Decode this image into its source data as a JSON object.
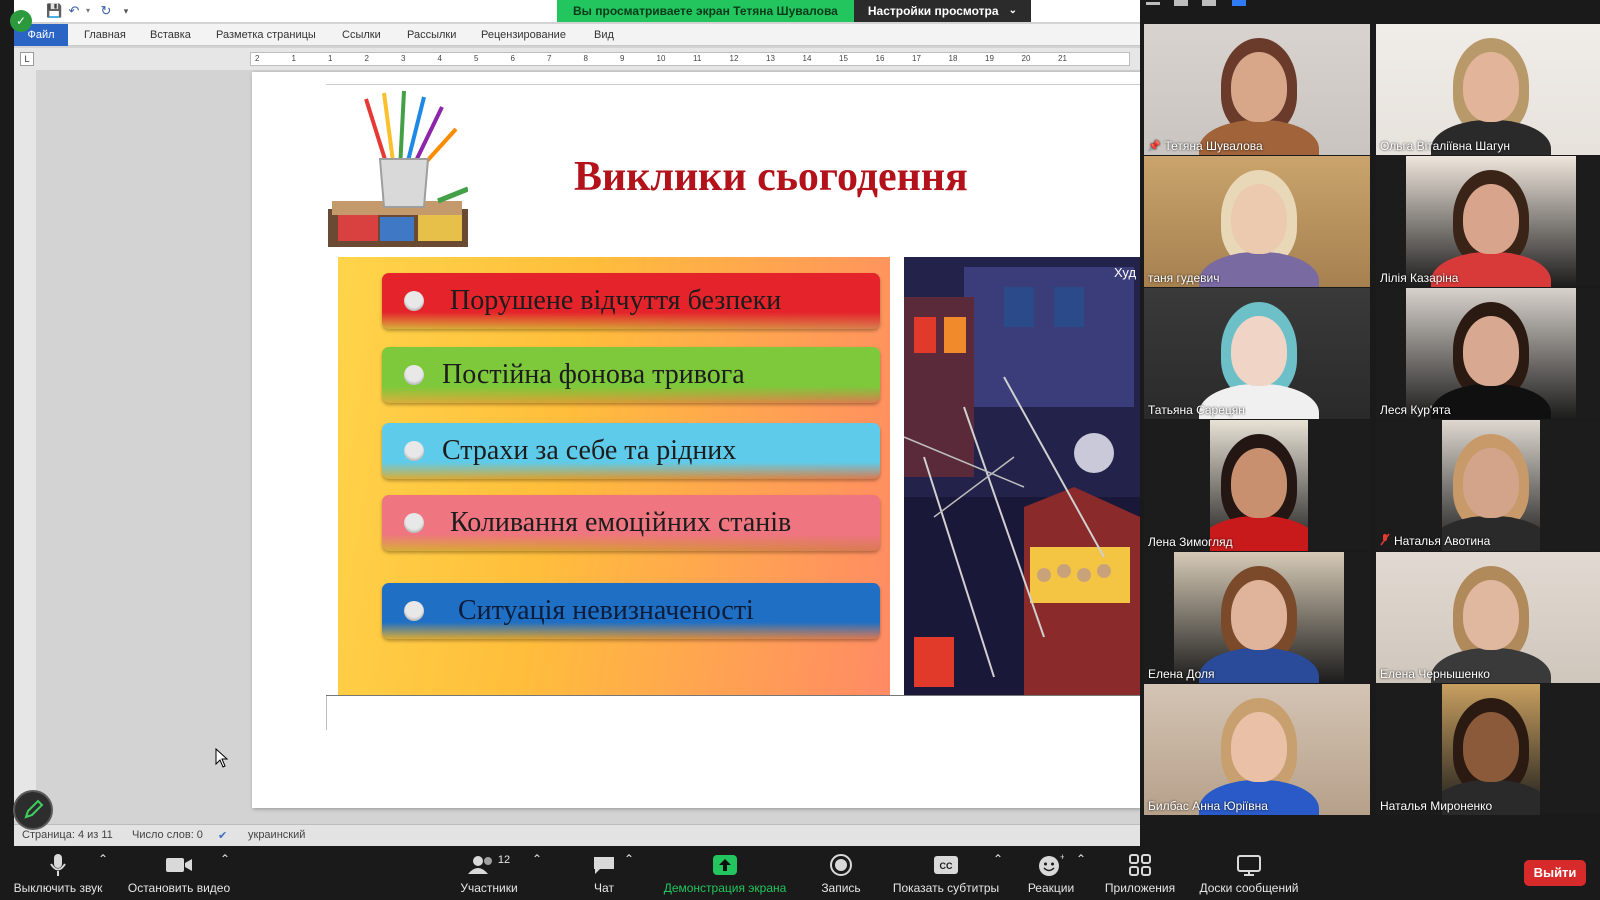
{
  "banner": {
    "viewing_text": "Вы просматриваете экран Тетяна Шувалова",
    "settings_label": "Настройки просмотра"
  },
  "word": {
    "ribbon_tabs": [
      "Файл",
      "Главная",
      "Вставка",
      "Разметка страницы",
      "Ссылки",
      "Рассылки",
      "Рецензирование",
      "Вид"
    ],
    "tab_selector": "L",
    "ruler_numbers": [
      "2",
      "1",
      "1",
      "2",
      "3",
      "4",
      "5",
      "6",
      "7",
      "8",
      "9",
      "10",
      "11",
      "12",
      "13",
      "14",
      "15",
      "16",
      "17",
      "18",
      "19",
      "20",
      "21"
    ],
    "status": {
      "page": "Страница: 4 из 11",
      "words": "Число слов: 0",
      "language": "украинский"
    }
  },
  "slide": {
    "title": "Виклики сьогодення",
    "items": [
      {
        "text": "Порушене відчуття безпеки",
        "color": "#e5232b"
      },
      {
        "text": "Постійна фонова тривога",
        "color": "#7dc93b"
      },
      {
        "text": "Страхи за себе та рідних",
        "color": "#5fcbea"
      },
      {
        "text": "Коливання емоційних станів",
        "color": "#ef7580"
      },
      {
        "text": "Ситуація невизначеності",
        "color": "#1f6fc4"
      }
    ],
    "art_label": "Худ"
  },
  "participants": [
    {
      "name": "Тетяна Шувалова",
      "pinned": true,
      "muted": false,
      "active": false
    },
    {
      "name": "Ольга Віталіївна Шагун",
      "pinned": false,
      "muted": false,
      "active": false
    },
    {
      "name": "таня гудевич",
      "pinned": false,
      "muted": false,
      "active": true
    },
    {
      "name": "Лілія Казаріна",
      "pinned": false,
      "muted": false,
      "active": false
    },
    {
      "name": "Татьяна Сарецян",
      "pinned": false,
      "muted": false,
      "active": false
    },
    {
      "name": "Леся Кур'ята",
      "pinned": false,
      "muted": false,
      "active": false
    },
    {
      "name": "Лена Зимогляд",
      "pinned": false,
      "muted": false,
      "active": false
    },
    {
      "name": "Наталья Авотина",
      "pinned": false,
      "muted": true,
      "active": false
    },
    {
      "name": "Елена Доля",
      "pinned": false,
      "muted": false,
      "active": false
    },
    {
      "name": "Елена Чернышенко",
      "pinned": false,
      "muted": false,
      "active": false
    },
    {
      "name": "Билбас Анна Юріївна",
      "pinned": false,
      "muted": false,
      "active": false
    },
    {
      "name": "Наталья Мироненко",
      "pinned": false,
      "muted": false,
      "active": false
    }
  ],
  "toolbar": {
    "mute_label": "Выключить звук",
    "video_label": "Остановить видео",
    "participants_label": "Участники",
    "participants_count": "12",
    "chat_label": "Чат",
    "share_label": "Демонстрация экрана",
    "record_label": "Запись",
    "captions_label": "Показать субтитры",
    "reactions_label": "Реакции",
    "apps_label": "Приложения",
    "whiteboard_label": "Доски сообщений",
    "leave_label": "Выйти"
  },
  "colors": {
    "share_green": "#22c55e",
    "leave_red": "#d72a2a",
    "active_speaker": "#e8e64a",
    "title_red": "#b3121a"
  }
}
